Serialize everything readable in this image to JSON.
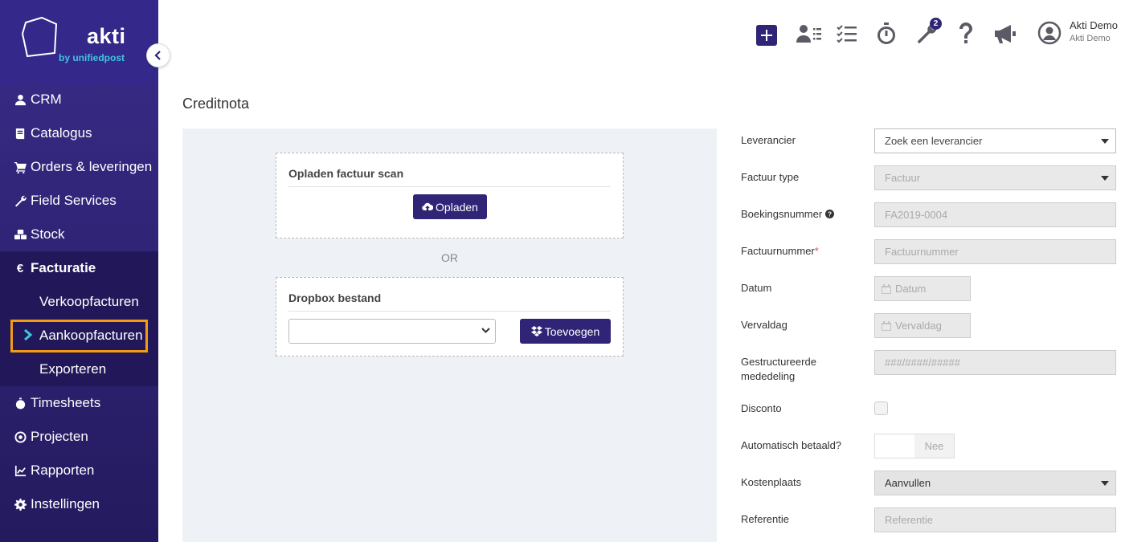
{
  "brand": {
    "name": "akti",
    "tagline": "by unifiedpost"
  },
  "sidebar": {
    "items": [
      {
        "label": "CRM",
        "icon": "user-icon"
      },
      {
        "label": "Catalogus",
        "icon": "book-icon"
      },
      {
        "label": "Orders & leveringen",
        "icon": "cart-icon"
      },
      {
        "label": "Field Services",
        "icon": "wrench-icon"
      },
      {
        "label": "Stock",
        "icon": "cubes-icon"
      },
      {
        "label": "Facturatie",
        "icon": "euro-icon"
      },
      {
        "label": "Timesheets",
        "icon": "stopwatch-icon"
      },
      {
        "label": "Projecten",
        "icon": "target-icon"
      },
      {
        "label": "Rapporten",
        "icon": "chart-icon"
      },
      {
        "label": "Instellingen",
        "icon": "gear-icon"
      }
    ],
    "facturatie_sub": [
      {
        "label": "Verkoopfacturen"
      },
      {
        "label": "Aankoopfacturen"
      },
      {
        "label": "Exporteren"
      }
    ]
  },
  "topbar": {
    "tools_badge": "2",
    "user_name": "Akti Demo",
    "user_company": "Akti Demo"
  },
  "page": {
    "title": "Creditnota"
  },
  "upload": {
    "scan_title": "Opladen factuur scan",
    "upload_button": "Opladen",
    "or_text": "OR",
    "dropbox_title": "Dropbox bestand",
    "add_button": "Toevoegen"
  },
  "form": {
    "leverancier_label": "Leverancier",
    "leverancier_value": "Zoek een leverancier",
    "factuur_type_label": "Factuur type",
    "factuur_type_value": "Factuur",
    "boekingsnummer_label": "Boekingsnummer",
    "boekingsnummer_value": "FA2019-0004",
    "factuurnummer_label": "Factuurnummer",
    "factuurnummer_required": "*",
    "factuurnummer_placeholder": "Factuurnummer",
    "datum_label": "Datum",
    "datum_placeholder": "Datum",
    "vervaldag_label": "Vervaldag",
    "vervaldag_placeholder": "Vervaldag",
    "mededeling_label_1": "Gestructureerde",
    "mededeling_label_2": "mededeling",
    "mededeling_placeholder": "###/####/#####",
    "disconto_label": "Disconto",
    "auto_betaald_label": "Automatisch betaald?",
    "auto_betaald_value": "Nee",
    "kostenplaats_label": "Kostenplaats",
    "kostenplaats_value": "Aanvullen",
    "referentie_label": "Referentie",
    "referentie_placeholder": "Referentie"
  },
  "colors": {
    "brand": "#2f2476",
    "highlight": "#f39c12",
    "accent": "#3ec6e0"
  }
}
